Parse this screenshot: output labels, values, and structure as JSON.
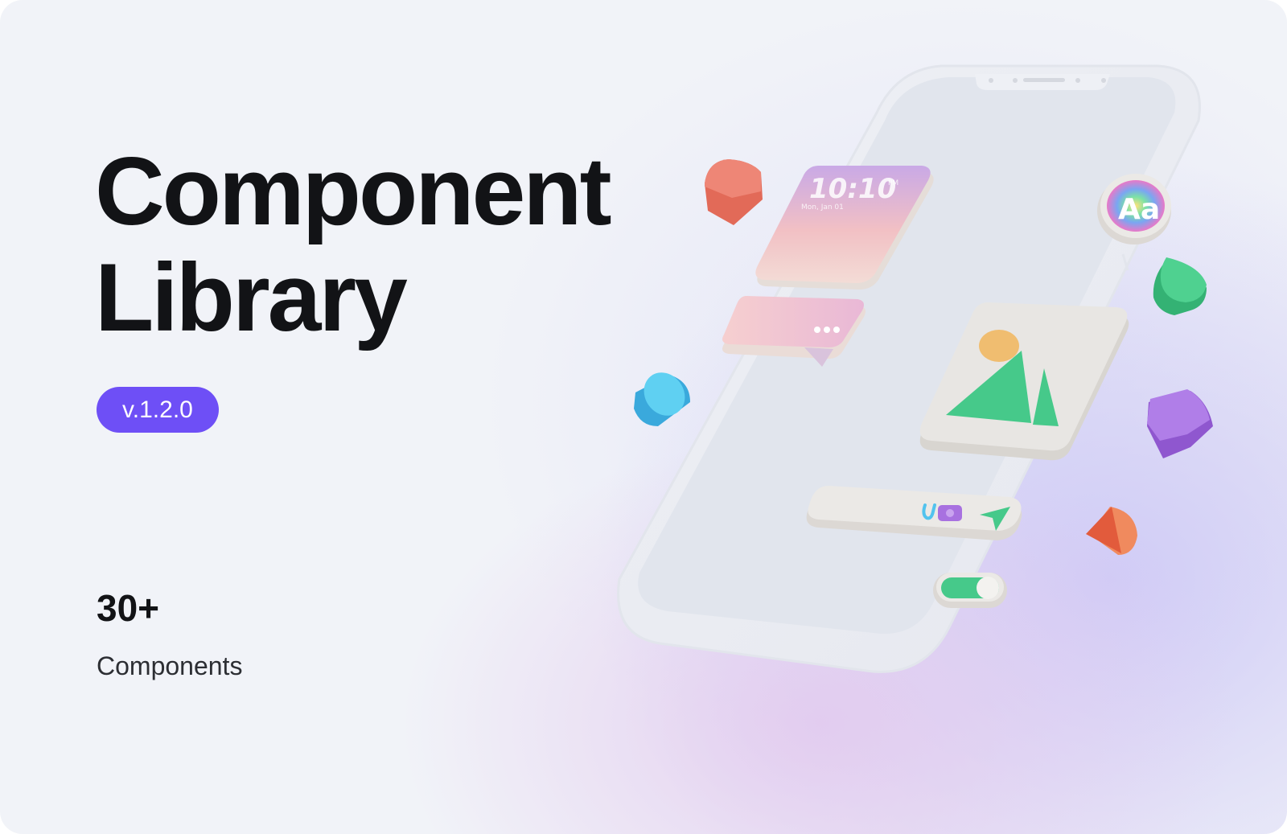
{
  "hero": {
    "title_line1": "Component",
    "title_line2": "Library",
    "version": "v.1.2.0"
  },
  "stats": {
    "count": "30+",
    "label": "Components"
  },
  "illustration": {
    "widget_time": "10:10",
    "widget_ampm": "PM",
    "widget_date": "Mon, Jan 01",
    "font_badge": "Aa"
  },
  "colors": {
    "accent": "#6e4ff6",
    "green": "#46c98a",
    "coral": "#ec7e6e",
    "blue": "#52c3ee",
    "purple": "#a871e0",
    "orange_red": "#e25b3c"
  }
}
